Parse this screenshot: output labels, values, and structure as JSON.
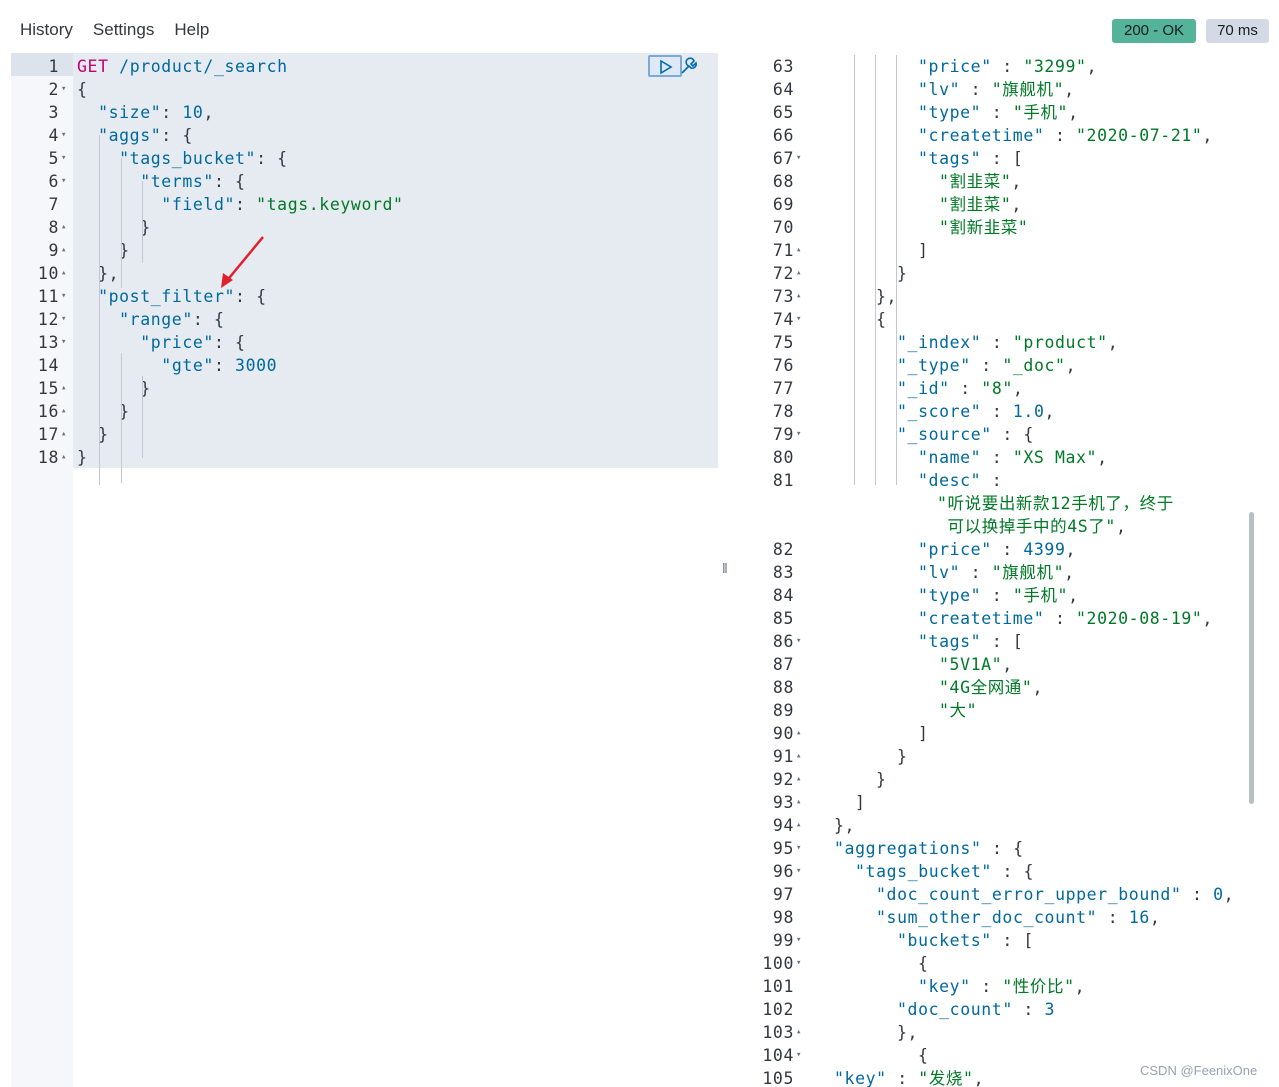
{
  "menu": {
    "history": "History",
    "settings": "Settings",
    "help": "Help"
  },
  "status": {
    "code": "200 - OK",
    "time": "70 ms"
  },
  "watermark": "CSDN @FeenixOne",
  "request": [
    {
      "n": "1",
      "f": "",
      "tokens": [
        [
          "m",
          "GET"
        ],
        [
          "p",
          " "
        ],
        [
          "k",
          "/product/_search"
        ]
      ]
    },
    {
      "n": "2",
      "f": "▾",
      "tokens": [
        [
          "p",
          "{"
        ]
      ]
    },
    {
      "n": "3",
      "f": "",
      "tokens": [
        [
          "p",
          "  "
        ],
        [
          "k",
          "\"size\""
        ],
        [
          "p",
          ": "
        ],
        [
          "n",
          "10"
        ],
        [
          "p",
          ","
        ]
      ]
    },
    {
      "n": "4",
      "f": "▾",
      "tokens": [
        [
          "p",
          "  "
        ],
        [
          "k",
          "\"aggs\""
        ],
        [
          "p",
          ": {"
        ]
      ]
    },
    {
      "n": "5",
      "f": "▾",
      "tokens": [
        [
          "p",
          "    "
        ],
        [
          "k",
          "\"tags_bucket\""
        ],
        [
          "p",
          ": {"
        ]
      ]
    },
    {
      "n": "6",
      "f": "▾",
      "tokens": [
        [
          "p",
          "      "
        ],
        [
          "k",
          "\"terms\""
        ],
        [
          "p",
          ": {"
        ]
      ]
    },
    {
      "n": "7",
      "f": "",
      "tokens": [
        [
          "p",
          "        "
        ],
        [
          "k",
          "\"field\""
        ],
        [
          "p",
          ": "
        ],
        [
          "s",
          "\"tags.keyword\""
        ]
      ]
    },
    {
      "n": "8",
      "f": "▴",
      "tokens": [
        [
          "p",
          "      }"
        ]
      ]
    },
    {
      "n": "9",
      "f": "▴",
      "tokens": [
        [
          "p",
          "    }"
        ]
      ]
    },
    {
      "n": "10",
      "f": "▴",
      "tokens": [
        [
          "p",
          "  },"
        ]
      ]
    },
    {
      "n": "11",
      "f": "▾",
      "tokens": [
        [
          "p",
          "  "
        ],
        [
          "k",
          "\"post_filter\""
        ],
        [
          "p",
          ": {"
        ]
      ]
    },
    {
      "n": "12",
      "f": "▾",
      "tokens": [
        [
          "p",
          "    "
        ],
        [
          "k",
          "\"range\""
        ],
        [
          "p",
          ": {"
        ]
      ]
    },
    {
      "n": "13",
      "f": "▾",
      "tokens": [
        [
          "p",
          "      "
        ],
        [
          "k",
          "\"price\""
        ],
        [
          "p",
          ": {"
        ]
      ]
    },
    {
      "n": "14",
      "f": "",
      "tokens": [
        [
          "p",
          "        "
        ],
        [
          "k",
          "\"gte\""
        ],
        [
          "p",
          ": "
        ],
        [
          "n",
          "3000"
        ]
      ]
    },
    {
      "n": "15",
      "f": "▴",
      "tokens": [
        [
          "p",
          "      }"
        ]
      ]
    },
    {
      "n": "16",
      "f": "▴",
      "tokens": [
        [
          "p",
          "    }"
        ]
      ]
    },
    {
      "n": "17",
      "f": "▴",
      "tokens": [
        [
          "p",
          "  }"
        ]
      ]
    },
    {
      "n": "18",
      "f": "▴",
      "tokens": [
        [
          "p",
          "}"
        ]
      ]
    }
  ],
  "response": [
    {
      "n": "63",
      "f": "",
      "tokens": [
        [
          "k",
          "\"price\""
        ],
        [
          "p",
          " : "
        ],
        [
          "s",
          "\"3299\""
        ],
        [
          "p",
          ","
        ]
      ]
    },
    {
      "n": "64",
      "f": "",
      "tokens": [
        [
          "k",
          "\"lv\""
        ],
        [
          "p",
          " : "
        ],
        [
          "s",
          "\"旗舰机\""
        ],
        [
          "p",
          ","
        ]
      ]
    },
    {
      "n": "65",
      "f": "",
      "tokens": [
        [
          "k",
          "\"type\""
        ],
        [
          "p",
          " : "
        ],
        [
          "s",
          "\"手机\""
        ],
        [
          "p",
          ","
        ]
      ]
    },
    {
      "n": "66",
      "f": "",
      "tokens": [
        [
          "k",
          "\"createtime\""
        ],
        [
          "p",
          " : "
        ],
        [
          "s",
          "\"2020-07-21\""
        ],
        [
          "p",
          ","
        ]
      ]
    },
    {
      "n": "67",
      "f": "▾",
      "tokens": [
        [
          "k",
          "\"tags\""
        ],
        [
          "p",
          " : ["
        ]
      ]
    },
    {
      "n": "68",
      "f": "",
      "tokens": [
        [
          "s",
          "\"割韭菜\""
        ],
        [
          "p",
          ","
        ]
      ]
    },
    {
      "n": "69",
      "f": "",
      "tokens": [
        [
          "s",
          "\"割韭菜\""
        ],
        [
          "p",
          ","
        ]
      ]
    },
    {
      "n": "70",
      "f": "",
      "tokens": [
        [
          "s",
          "\"割新韭菜\""
        ]
      ]
    },
    {
      "n": "71",
      "f": "▴",
      "tokens": [
        [
          "p",
          "]"
        ]
      ]
    },
    {
      "n": "72",
      "f": "▴",
      "tokens": [
        [
          "p",
          "}"
        ]
      ]
    },
    {
      "n": "73",
      "f": "▴",
      "tokens": [
        [
          "p",
          "},"
        ]
      ]
    },
    {
      "n": "74",
      "f": "▾",
      "tokens": [
        [
          "p",
          "{"
        ]
      ]
    },
    {
      "n": "75",
      "f": "",
      "tokens": [
        [
          "k",
          "\"_index\""
        ],
        [
          "p",
          " : "
        ],
        [
          "s",
          "\"product\""
        ],
        [
          "p",
          ","
        ]
      ]
    },
    {
      "n": "76",
      "f": "",
      "tokens": [
        [
          "k",
          "\"_type\""
        ],
        [
          "p",
          " : "
        ],
        [
          "s",
          "\"_doc\""
        ],
        [
          "p",
          ","
        ]
      ]
    },
    {
      "n": "77",
      "f": "",
      "tokens": [
        [
          "k",
          "\"_id\""
        ],
        [
          "p",
          " : "
        ],
        [
          "s",
          "\"8\""
        ],
        [
          "p",
          ","
        ]
      ]
    },
    {
      "n": "78",
      "f": "",
      "tokens": [
        [
          "k",
          "\"_score\""
        ],
        [
          "p",
          " : "
        ],
        [
          "n",
          "1.0"
        ],
        [
          "p",
          ","
        ]
      ]
    },
    {
      "n": "79",
      "f": "▾",
      "tokens": [
        [
          "k",
          "\"_source\""
        ],
        [
          "p",
          " : {"
        ]
      ]
    },
    {
      "n": "80",
      "f": "",
      "tokens": [
        [
          "k",
          "\"name\""
        ],
        [
          "p",
          " : "
        ],
        [
          "s",
          "\"XS Max\""
        ],
        [
          "p",
          ","
        ]
      ]
    },
    {
      "n": "81",
      "f": "",
      "tokens": [
        [
          "k",
          "\"desc\""
        ],
        [
          "p",
          " :"
        ]
      ]
    },
    {
      "n": "",
      "f": "",
      "tokens": [
        [
          "s",
          "\"听说要出新款12手机了，终于"
        ]
      ]
    },
    {
      "n": "",
      "f": "",
      "tokens": [
        [
          "s",
          " 可以换掉手中的4S了\""
        ],
        [
          "p",
          ","
        ]
      ]
    },
    {
      "n": "82",
      "f": "",
      "tokens": [
        [
          "k",
          "\"price\""
        ],
        [
          "p",
          " : "
        ],
        [
          "n",
          "4399"
        ],
        [
          "p",
          ","
        ]
      ]
    },
    {
      "n": "83",
      "f": "",
      "tokens": [
        [
          "k",
          "\"lv\""
        ],
        [
          "p",
          " : "
        ],
        [
          "s",
          "\"旗舰机\""
        ],
        [
          "p",
          ","
        ]
      ]
    },
    {
      "n": "84",
      "f": "",
      "tokens": [
        [
          "k",
          "\"type\""
        ],
        [
          "p",
          " : "
        ],
        [
          "s",
          "\"手机\""
        ],
        [
          "p",
          ","
        ]
      ]
    },
    {
      "n": "85",
      "f": "",
      "tokens": [
        [
          "k",
          "\"createtime\""
        ],
        [
          "p",
          " : "
        ],
        [
          "s",
          "\"2020-08-19\""
        ],
        [
          "p",
          ","
        ]
      ]
    },
    {
      "n": "86",
      "f": "▾",
      "tokens": [
        [
          "k",
          "\"tags\""
        ],
        [
          "p",
          " : ["
        ]
      ]
    },
    {
      "n": "87",
      "f": "",
      "tokens": [
        [
          "s",
          "\"5V1A\""
        ],
        [
          "p",
          ","
        ]
      ]
    },
    {
      "n": "88",
      "f": "",
      "tokens": [
        [
          "s",
          "\"4G全网通\""
        ],
        [
          "p",
          ","
        ]
      ]
    },
    {
      "n": "89",
      "f": "",
      "tokens": [
        [
          "s",
          "\"大\""
        ]
      ]
    },
    {
      "n": "90",
      "f": "▴",
      "tokens": [
        [
          "p",
          "]"
        ]
      ]
    },
    {
      "n": "91",
      "f": "▴",
      "tokens": [
        [
          "p",
          "}"
        ]
      ]
    },
    {
      "n": "92",
      "f": "▴",
      "tokens": [
        [
          "p",
          "}"
        ]
      ]
    },
    {
      "n": "93",
      "f": "▴",
      "tokens": [
        [
          "p",
          "]"
        ]
      ]
    },
    {
      "n": "94",
      "f": "▴",
      "tokens": [
        [
          "p",
          "},"
        ]
      ]
    },
    {
      "n": "95",
      "f": "▾",
      "tokens": [
        [
          "k",
          "\"aggregations\""
        ],
        [
          "p",
          " : {"
        ]
      ]
    },
    {
      "n": "96",
      "f": "▾",
      "tokens": [
        [
          "k",
          "\"tags_bucket\""
        ],
        [
          "p",
          " : {"
        ]
      ]
    },
    {
      "n": "97",
      "f": "",
      "tokens": [
        [
          "k",
          "\"doc_count_error_upper_bound\""
        ],
        [
          "p",
          " : "
        ],
        [
          "n",
          "0"
        ],
        [
          "p",
          ","
        ]
      ]
    },
    {
      "n": "98",
      "f": "",
      "tokens": [
        [
          "k",
          "\"sum_other_doc_count\""
        ],
        [
          "p",
          " : "
        ],
        [
          "n",
          "16"
        ],
        [
          "p",
          ","
        ]
      ]
    },
    {
      "n": "99",
      "f": "▾",
      "tokens": [
        [
          "k",
          "\"buckets\""
        ],
        [
          "p",
          " : ["
        ]
      ]
    },
    {
      "n": "100",
      "f": "▾",
      "tokens": [
        [
          "p",
          "{"
        ]
      ]
    },
    {
      "n": "101",
      "f": "",
      "tokens": [
        [
          "k",
          "\"key\""
        ],
        [
          "p",
          " : "
        ],
        [
          "s",
          "\"性价比\""
        ],
        [
          "p",
          ","
        ]
      ]
    },
    {
      "n": "102",
      "f": "",
      "tokens": [
        [
          "k",
          "\"doc_count\""
        ],
        [
          "p",
          " : "
        ],
        [
          "n",
          "3"
        ]
      ]
    },
    {
      "n": "103",
      "f": "▴",
      "tokens": [
        [
          "p",
          "},"
        ]
      ]
    },
    {
      "n": "104",
      "f": "▾",
      "tokens": [
        [
          "p",
          "{"
        ]
      ]
    },
    {
      "n": "105",
      "f": "",
      "tokens": [
        [
          "k",
          "\"key\""
        ],
        [
          "p",
          " : "
        ],
        [
          "s",
          "\"发烧\""
        ],
        [
          "p",
          ","
        ]
      ]
    }
  ]
}
